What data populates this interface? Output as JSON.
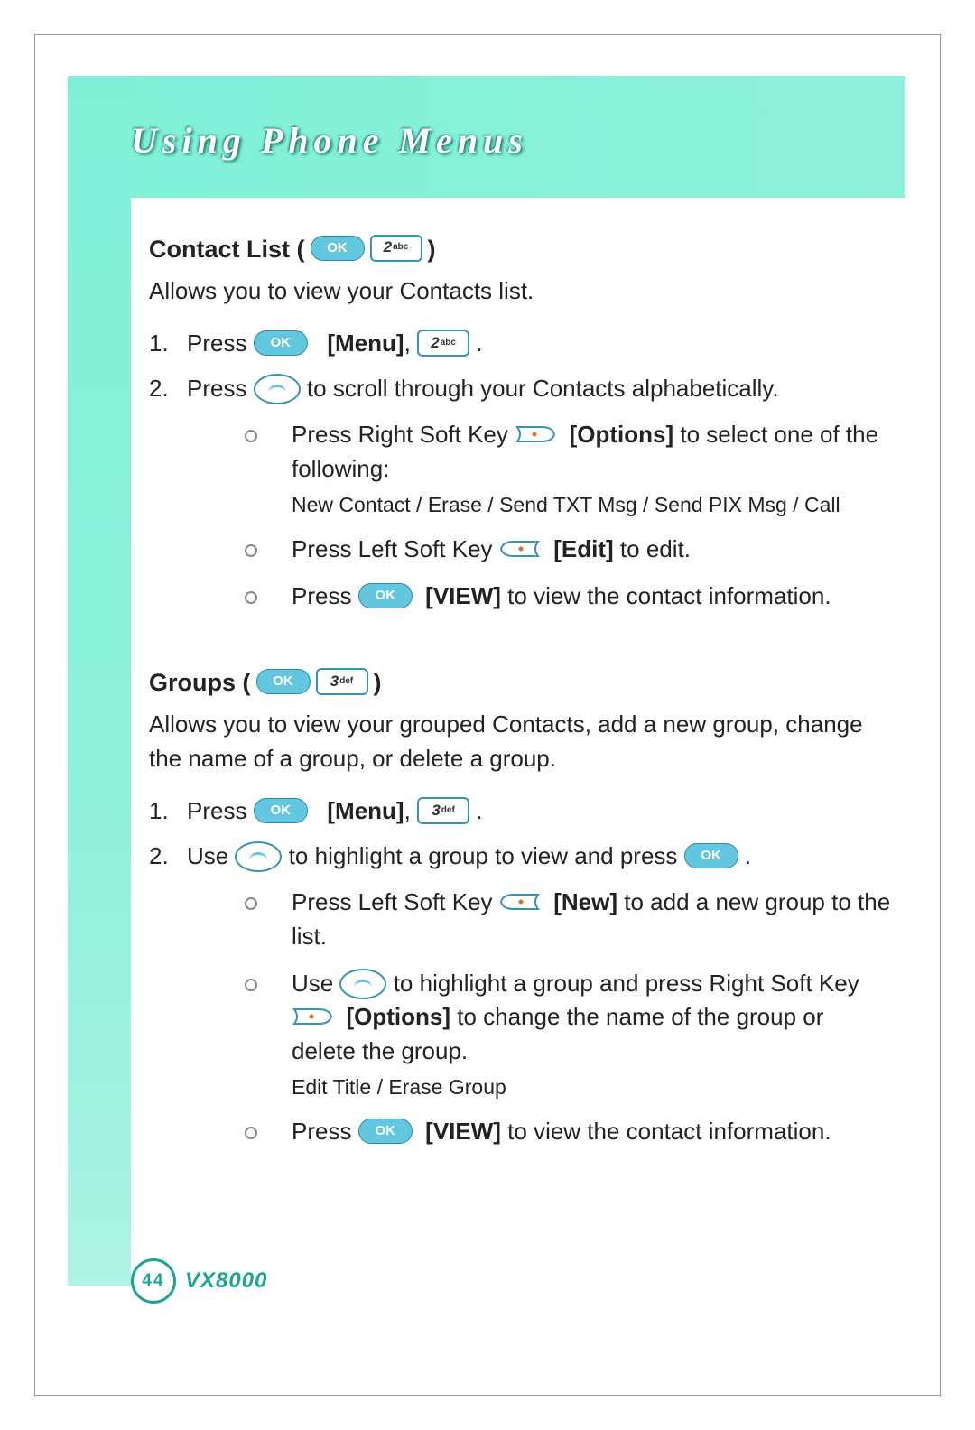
{
  "page_title": "Using Phone Menus",
  "icons": {
    "ok_label": "OK",
    "key2_digit": "2",
    "key2_letters": "abc",
    "key3_digit": "3",
    "key3_letters": "def"
  },
  "labels": {
    "menu": "[Menu]",
    "options": "[Options]",
    "edit": "[Edit]",
    "view": "[VIEW]",
    "new": "[New]"
  },
  "contact_list": {
    "title": "Contact List (",
    "title_close": ")",
    "desc": "Allows you to view your Contacts list.",
    "step1_prefix": "1.",
    "step1_press": "Press ",
    "step1_comma": ", ",
    "step1_period": " .",
    "step2_prefix": "2.",
    "step2_press": "Press ",
    "step2_tail": " to scroll through your Contacts alphabetically.",
    "sub1_a": "Press Right Soft Key ",
    "sub1_b": " to select one of the following:",
    "sub1_small": "New Contact / Erase / Send TXT Msg / Send PIX Msg / Call",
    "sub2_a": "Press Left Soft Key ",
    "sub2_b": " to edit.",
    "sub3_a": "Press ",
    "sub3_b": " to view the contact information."
  },
  "groups": {
    "title": "Groups (",
    "title_close": ")",
    "desc": "Allows you to view your grouped Contacts, add a new group, change the name of a group, or delete a group.",
    "step1_prefix": "1.",
    "step1_press": "Press ",
    "step1_comma": ", ",
    "step1_period": " .",
    "step2_prefix": "2.",
    "step2_use": "Use ",
    "step2_mid": " to highlight a group to view and press ",
    "step2_period": " .",
    "sub1_a": "Press Left Soft Key ",
    "sub1_b": " to add a new group to the list.",
    "sub2_a": "Use ",
    "sub2_b": " to highlight a group and press Right Soft Key ",
    "sub2_c": " to change the name of the group or delete the group.",
    "sub2_small": "Edit Title / Erase Group",
    "sub3_a": "Press ",
    "sub3_b": " to view the contact information."
  },
  "footer": {
    "page_number": "44",
    "model": "VX8000"
  }
}
